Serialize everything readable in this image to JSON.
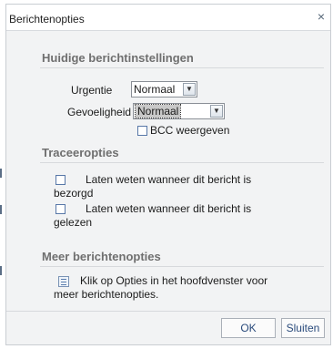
{
  "dialog": {
    "title": "Berichtenopties",
    "close_glyph": "×"
  },
  "current_settings": {
    "heading": "Huidige berichtinstellingen",
    "urgency_label": "Urgentie",
    "urgency_value": "Normaal",
    "sensitivity_label": "Gevoeligheid",
    "sensitivity_value": "Normaal",
    "bcc_label": "BCC weergeven",
    "bcc_checked": false
  },
  "tracking": {
    "heading": "Traceeropties",
    "delivered_line1": "Laten weten wanneer dit bericht is",
    "delivered_line2": "bezorgd",
    "read_line1": "Laten weten wanneer dit bericht is",
    "read_line2": "gelezen"
  },
  "more": {
    "heading": "Meer berichtenopties",
    "info_line1": "Klik op Opties in het hoofdvenster voor",
    "info_line2": "meer berichtenopties."
  },
  "buttons": {
    "ok": "OK",
    "close": "Sluiten"
  },
  "icons": {
    "close": "close-icon",
    "dropdown": "chevron-down-icon",
    "info": "options-info-icon"
  },
  "colors": {
    "section_heading": "#6f6f6f",
    "button_text": "#2a4b7c",
    "checkbox_border": "#5878a8"
  }
}
